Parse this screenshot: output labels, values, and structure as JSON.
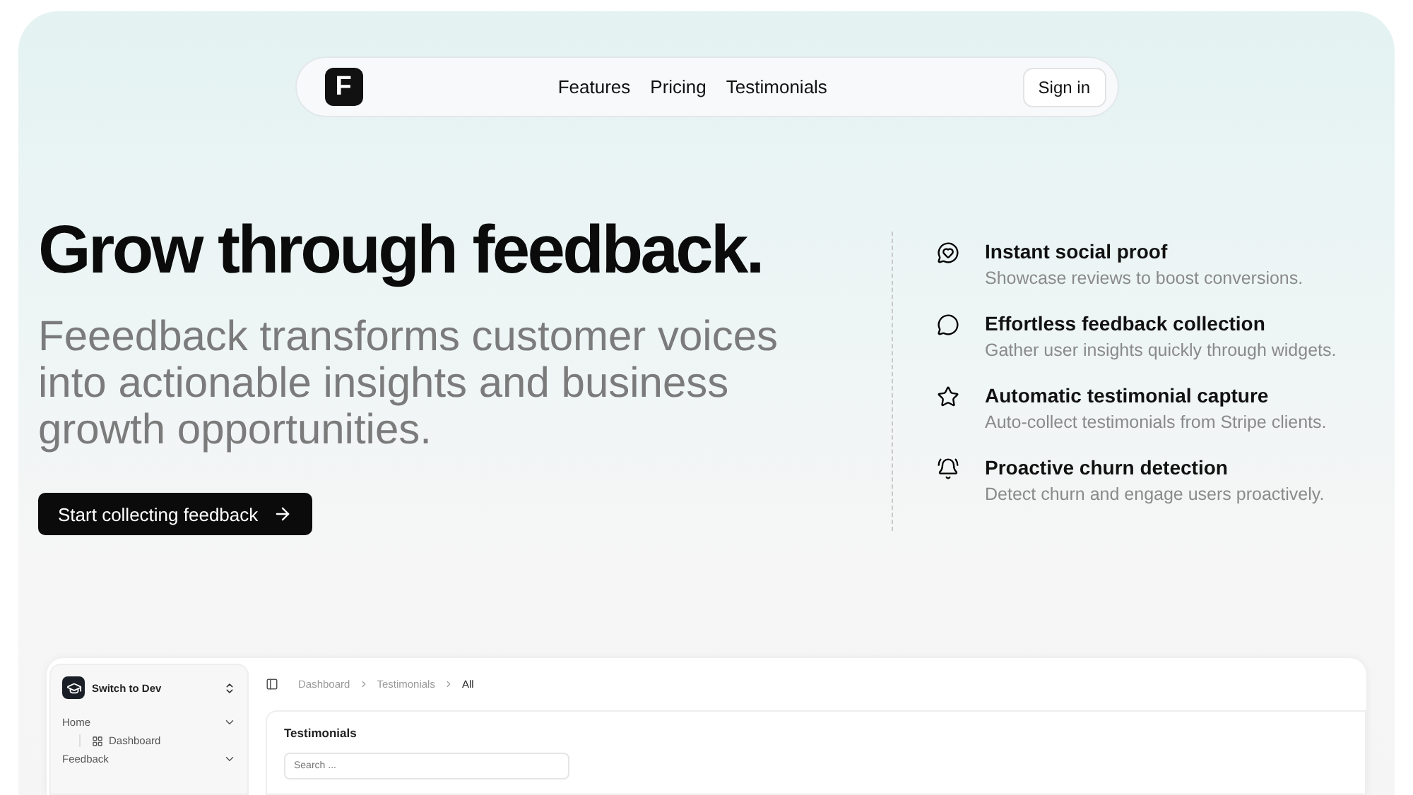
{
  "nav": {
    "logo": "F",
    "links": [
      "Features",
      "Pricing",
      "Testimonials"
    ],
    "sign_in": "Sign in"
  },
  "hero": {
    "title": "Grow through feedback.",
    "subtitle": "Feeedback transforms customer voices into actionable insights and business growth opportunities.",
    "cta": "Start collecting feedback"
  },
  "features": [
    {
      "kind": "heart-chat",
      "title": "Instant social proof",
      "text": "Showcase reviews to boost conversions."
    },
    {
      "kind": "chat",
      "title": "Effortless feedback collection",
      "text": "Gather user insights quickly through widgets."
    },
    {
      "kind": "star",
      "title": "Automatic testimonial capture",
      "text": "Auto-collect testimonials from Stripe clients."
    },
    {
      "kind": "bell",
      "title": "Proactive churn detection",
      "text": "Detect churn and engage users proactively."
    }
  ],
  "preview": {
    "workspace": "Switch to Dev",
    "sidebar": [
      {
        "label": "Home",
        "expanded": true,
        "children": [
          {
            "label": "Dashboard"
          }
        ]
      },
      {
        "label": "Feedback",
        "expanded": true
      }
    ],
    "breadcrumb": [
      "Dashboard",
      "Testimonials",
      "All"
    ],
    "panel_title": "Testimonials",
    "search": {
      "placeholder": "Search ..."
    }
  }
}
